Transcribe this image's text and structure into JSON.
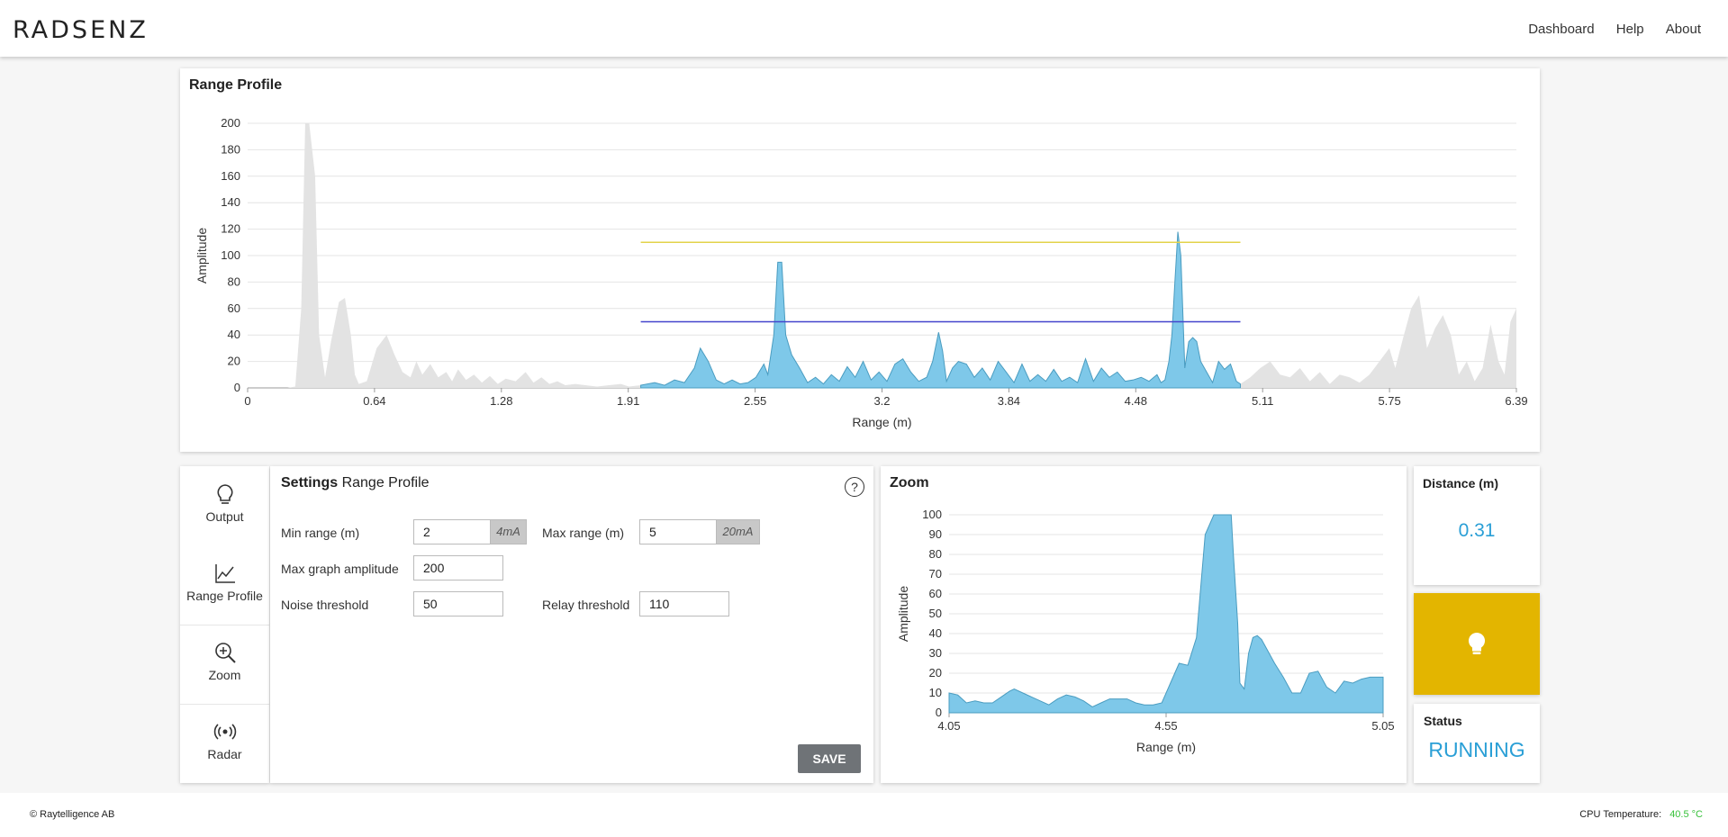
{
  "header": {
    "logo": "RADSENZ",
    "nav": [
      "Dashboard",
      "Help",
      "About"
    ]
  },
  "range_profile": {
    "title": "Range Profile",
    "chart_data": {
      "type": "area",
      "xlabel": "Range (m)",
      "ylabel": "Amplitude",
      "xlim": [
        0,
        6.39
      ],
      "ylim": [
        0,
        200
      ],
      "x_ticks": [
        "0",
        "0.64",
        "1.28",
        "1.91",
        "2.55",
        "3.2",
        "3.84",
        "4.48",
        "5.11",
        "5.75",
        "6.39"
      ],
      "y_ticks": [
        0,
        20,
        40,
        60,
        80,
        100,
        120,
        140,
        160,
        180,
        200
      ],
      "grid": true,
      "highlight_range": [
        1.98,
        5.0
      ],
      "relay_threshold": 110,
      "noise_threshold": 50,
      "colors": {
        "full": "#e3e3e3",
        "highlight": "#7ec8e9",
        "highlight_stroke": "#4a9cc0",
        "relay": "#e3d34a",
        "noise": "#4444cc"
      },
      "series": [
        {
          "x": [
            0,
            0.1,
            0.2,
            0.24,
            0.27,
            0.29,
            0.31,
            0.34,
            0.36,
            0.39,
            0.42,
            0.46,
            0.49,
            0.52,
            0.54,
            0.56,
            0.6,
            0.65,
            0.7,
            0.74,
            0.78,
            0.82,
            0.85,
            0.88,
            0.92,
            0.96,
            1.0,
            1.03,
            1.06,
            1.1,
            1.14,
            1.18,
            1.22,
            1.26,
            1.3,
            1.35,
            1.4,
            1.44,
            1.48,
            1.52,
            1.56,
            1.6,
            1.65,
            1.7,
            1.76,
            1.82,
            1.88,
            1.92,
            1.98,
            2.05,
            2.1,
            2.15,
            2.2,
            2.25,
            2.28,
            2.32,
            2.36,
            2.4,
            2.44,
            2.48,
            2.52,
            2.56,
            2.6,
            2.62,
            2.65,
            2.67,
            2.69,
            2.71,
            2.74,
            2.78,
            2.82,
            2.86,
            2.9,
            2.94,
            2.98,
            3.02,
            3.06,
            3.1,
            3.14,
            3.18,
            3.22,
            3.26,
            3.3,
            3.34,
            3.38,
            3.42,
            3.45,
            3.48,
            3.5,
            3.52,
            3.55,
            3.58,
            3.62,
            3.66,
            3.7,
            3.74,
            3.78,
            3.82,
            3.86,
            3.9,
            3.94,
            3.98,
            4.02,
            4.06,
            4.1,
            4.14,
            4.18,
            4.22,
            4.26,
            4.3,
            4.34,
            4.38,
            4.42,
            4.46,
            4.5,
            4.54,
            4.58,
            4.6,
            4.62,
            4.64,
            4.655,
            4.67,
            4.685,
            4.7,
            4.72,
            4.74,
            4.76,
            4.78,
            4.8,
            4.83,
            4.86,
            4.89,
            4.92,
            4.95,
            4.98,
            5.0,
            5.05,
            5.1,
            5.15,
            5.2,
            5.25,
            5.3,
            5.35,
            5.4,
            5.45,
            5.5,
            5.55,
            5.6,
            5.65,
            5.7,
            5.75,
            5.78,
            5.82,
            5.86,
            5.9,
            5.94,
            5.98,
            6.02,
            6.06,
            6.1,
            6.14,
            6.18,
            6.22,
            6.26,
            6.3,
            6.33,
            6.36,
            6.39
          ],
          "y": [
            0,
            0,
            0,
            1,
            60,
            200,
            200,
            160,
            40,
            8,
            35,
            65,
            68,
            40,
            10,
            3,
            5,
            30,
            40,
            25,
            12,
            8,
            20,
            10,
            18,
            8,
            12,
            5,
            14,
            6,
            10,
            4,
            9,
            3,
            7,
            5,
            12,
            4,
            8,
            3,
            5,
            2,
            3,
            2,
            1,
            2,
            3,
            1,
            2,
            4,
            2,
            6,
            4,
            15,
            30,
            20,
            6,
            3,
            6,
            3,
            4,
            8,
            18,
            10,
            40,
            95,
            95,
            40,
            25,
            15,
            4,
            8,
            3,
            10,
            5,
            16,
            8,
            20,
            6,
            12,
            5,
            18,
            22,
            12,
            5,
            8,
            20,
            42,
            28,
            5,
            15,
            20,
            18,
            8,
            15,
            6,
            20,
            12,
            4,
            18,
            5,
            10,
            5,
            14,
            5,
            8,
            4,
            22,
            5,
            15,
            8,
            12,
            5,
            6,
            8,
            5,
            10,
            4,
            6,
            20,
            40,
            80,
            118,
            100,
            15,
            35,
            38,
            35,
            20,
            12,
            4,
            20,
            14,
            18,
            5,
            3,
            8,
            15,
            20,
            10,
            8,
            15,
            5,
            12,
            3,
            10,
            8,
            4,
            10,
            20,
            30,
            15,
            38,
            60,
            70,
            30,
            45,
            55,
            40,
            10,
            20,
            5,
            15,
            48,
            20,
            10,
            50,
            60,
            25
          ]
        }
      ]
    }
  },
  "sidebar": {
    "items": [
      {
        "label": "Output",
        "icon": "lightbulb-icon"
      },
      {
        "label": "Range Profile",
        "icon": "line-chart-icon"
      },
      {
        "label": "Zoom",
        "icon": "zoom-in-icon"
      },
      {
        "label": "Radar",
        "icon": "radar-icon"
      }
    ]
  },
  "settings": {
    "title_bold": "Settings",
    "title_rest": "Range Profile",
    "help": "?",
    "min_range_label": "Min range (m)",
    "min_range_value": "2",
    "min_range_unit": "4mA",
    "max_range_label": "Max range (m)",
    "max_range_value": "5",
    "max_range_unit": "20mA",
    "max_graph_amplitude_label": "Max graph amplitude",
    "max_graph_amplitude_value": "200",
    "noise_threshold_label": "Noise threshold",
    "noise_threshold_value": "50",
    "relay_threshold_label": "Relay threshold",
    "relay_threshold_value": "110",
    "save_label": "SAVE"
  },
  "zoom": {
    "title": "Zoom",
    "chart_data": {
      "type": "area",
      "xlabel": "Range (m)",
      "ylabel": "Amplitude",
      "xlim": [
        4.05,
        5.05
      ],
      "ylim": [
        0,
        100
      ],
      "x_ticks": [
        "4.05",
        "4.55",
        "5.05"
      ],
      "y_ticks": [
        0,
        10,
        20,
        30,
        40,
        50,
        60,
        70,
        80,
        90,
        100
      ],
      "grid": true,
      "colors": {
        "fill": "#7ec8e9",
        "stroke": "#4a9cc0"
      },
      "series": [
        {
          "x": [
            4.05,
            4.07,
            4.09,
            4.11,
            4.13,
            4.15,
            4.17,
            4.19,
            4.2,
            4.22,
            4.24,
            4.26,
            4.28,
            4.3,
            4.32,
            4.34,
            4.36,
            4.38,
            4.4,
            4.42,
            4.44,
            4.46,
            4.48,
            4.5,
            4.52,
            4.54,
            4.56,
            4.58,
            4.6,
            4.62,
            4.64,
            4.66,
            4.68,
            4.7,
            4.705,
            4.715,
            4.72,
            4.73,
            4.74,
            4.75,
            4.76,
            4.77,
            4.78,
            4.8,
            4.82,
            4.84,
            4.86,
            4.88,
            4.9,
            4.92,
            4.94,
            4.96,
            4.98,
            5.0,
            5.02,
            5.05
          ],
          "y": [
            10,
            9,
            5,
            6,
            5,
            5,
            8,
            11,
            12,
            10,
            8,
            6,
            4,
            7,
            9,
            8,
            6,
            3,
            5,
            7,
            7,
            7,
            5,
            4,
            4,
            5,
            15,
            25,
            24,
            38,
            90,
            100,
            100,
            100,
            80,
            45,
            15,
            12,
            30,
            38,
            39,
            37,
            33,
            25,
            18,
            10,
            10,
            20,
            21,
            13,
            10,
            16,
            15,
            17,
            18,
            18
          ]
        }
      ]
    }
  },
  "distance": {
    "title": "Distance (m)",
    "value": "0.31"
  },
  "indicator": {
    "color": "#e3b500",
    "icon": "lightbulb-icon"
  },
  "status": {
    "title": "Status",
    "value": "RUNNING"
  },
  "footer": {
    "copyright": "© Raytelligence AB",
    "cpu_label": "CPU Temperature:",
    "cpu_value": "40.5 °C"
  }
}
